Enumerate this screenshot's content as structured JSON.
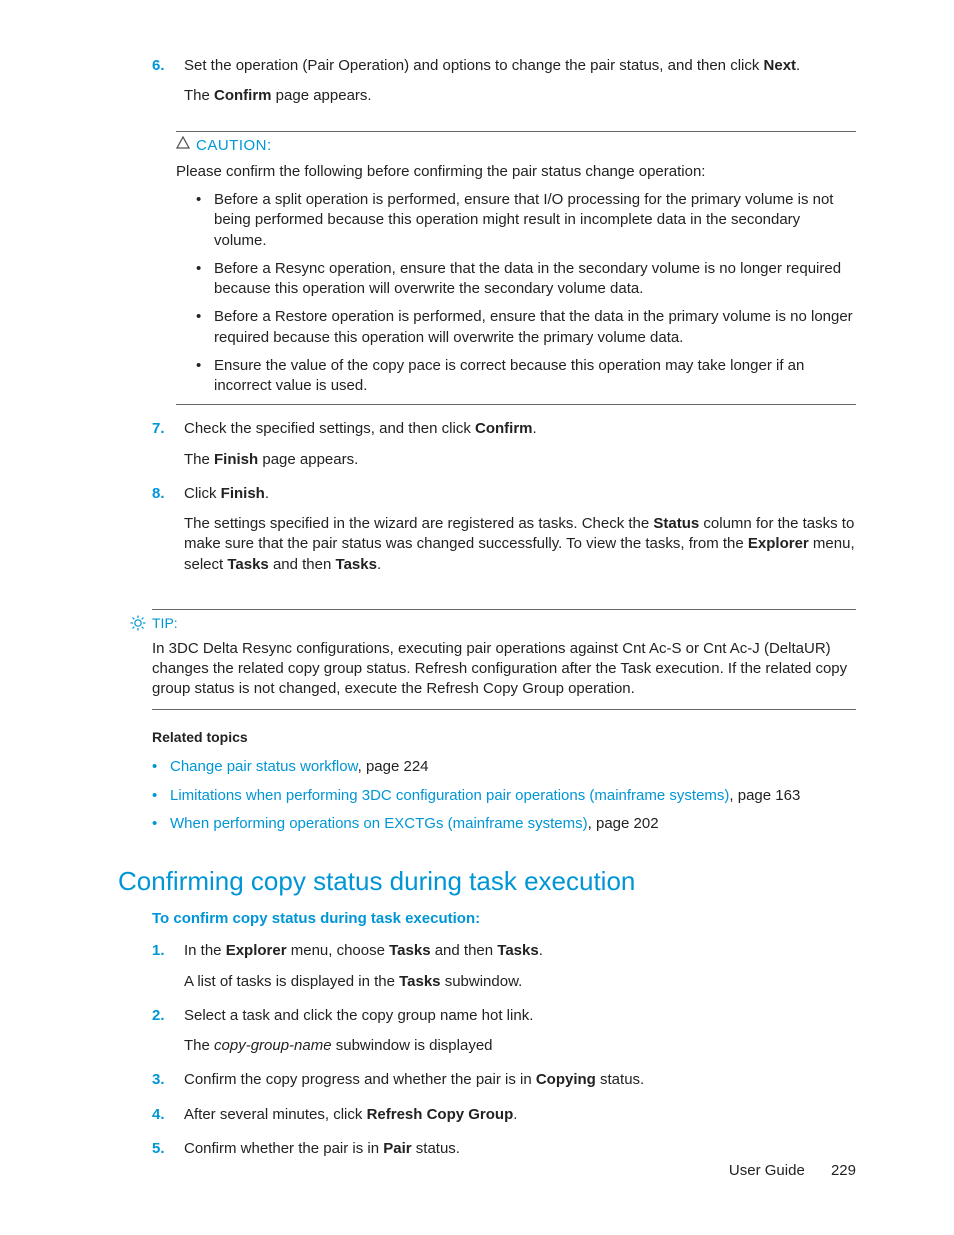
{
  "step6": {
    "num": "6.",
    "text_a": "Set the operation (Pair Operation) and options to change the pair status, and then click ",
    "bold_a": "Next",
    "text_b": ".",
    "line2_a": "The ",
    "line2_bold": "Confirm",
    "line2_b": " page appears."
  },
  "caution": {
    "title": "CAUTION:",
    "intro": "Please confirm the following before confirming the pair status change operation:",
    "items": [
      "Before a split operation is performed, ensure that I/O processing for the primary volume is not being performed because this operation might result in incomplete data in the secondary volume.",
      "Before a Resync operation, ensure that the data in the secondary volume is no longer required because this operation will overwrite the secondary volume data.",
      "Before a Restore operation is performed, ensure that the data in the primary volume is no longer required because this operation will overwrite the primary volume data.",
      "Ensure the value of the copy pace is correct because this operation may take longer if an incorrect value is used."
    ]
  },
  "step7": {
    "num": "7.",
    "text_a": "Check the specified settings, and then click ",
    "bold_a": "Confirm",
    "text_b": ".",
    "line2_a": "The ",
    "line2_bold": "Finish",
    "line2_b": " page appears."
  },
  "step8": {
    "num": "8.",
    "text_a": "Click ",
    "bold_a": "Finish",
    "text_b": ".",
    "para_a": "The settings specified in the wizard are registered as tasks. Check the ",
    "para_bold1": "Status",
    "para_b": " column for the tasks to make sure that the pair status was changed successfully. To view the tasks, from the ",
    "para_bold2": "Explorer",
    "para_c": " menu, select ",
    "para_bold3": "Tasks",
    "para_d": " and then ",
    "para_bold4": "Tasks",
    "para_e": "."
  },
  "tip": {
    "title": "TIP:",
    "body": "In 3DC Delta Resync configurations, executing pair operations against Cnt Ac-S or Cnt Ac-J (DeltaUR) changes the related copy group status. Refresh configuration after the Task execution. If the related copy group status is not changed, execute the Refresh Copy Group operation."
  },
  "related": {
    "title": "Related topics",
    "items": [
      {
        "link": "Change pair status workflow",
        "suffix": ", page 224"
      },
      {
        "link": "Limitations when performing 3DC configuration pair operations (mainframe systems)",
        "suffix": ", page 163"
      },
      {
        "link": "When performing operations on EXCTGs (mainframe systems)",
        "suffix": ", page 202"
      }
    ]
  },
  "section": {
    "heading": "Confirming copy status during task execution",
    "subhead": "To confirm copy status during task execution:"
  },
  "s1": {
    "num": "1.",
    "a": "In the ",
    "b1": "Explorer",
    "b": " menu, choose ",
    "b2": "Tasks",
    "c": " and then ",
    "b3": "Tasks",
    "d": ".",
    "l2a": "A list of tasks is displayed in the ",
    "l2b": "Tasks",
    "l2c": " subwindow."
  },
  "s2": {
    "num": "2.",
    "a": "Select a task and click the copy group name hot link.",
    "l2a": "The ",
    "l2i": "copy-group-name",
    "l2b": " subwindow is displayed"
  },
  "s3": {
    "num": "3.",
    "a": "Confirm the copy progress and whether the pair is in ",
    "b1": "Copying",
    "b": " status."
  },
  "s4": {
    "num": "4.",
    "a": "After several minutes, click ",
    "b1": "Refresh Copy Group",
    "b": "."
  },
  "s5": {
    "num": "5.",
    "a": "Confirm whether the pair is in ",
    "b1": "Pair",
    "b": " status."
  },
  "footer": {
    "label": "User Guide",
    "page": "229"
  }
}
